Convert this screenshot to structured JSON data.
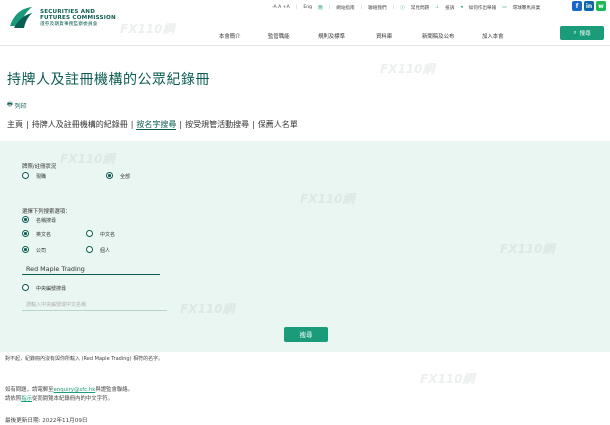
{
  "header": {
    "org_line1": "SECURITIES AND",
    "org_line2": "FUTURES COMMISSION",
    "org_chinese": "證券及期貨事務監察委員會",
    "utility": [
      "-A A +A",
      "Eng",
      "簡",
      "網站指南",
      "聯絡我們",
      "常見問題",
      "投訴",
      "如何作出舉報",
      "環球賽馬商業",
      "新聞稿"
    ],
    "search_label": "搜尋",
    "nav": [
      "本會簡介",
      "監管職能",
      "規則及標準",
      "資料庫",
      "新聞稿及公布",
      "加入本會"
    ]
  },
  "page": {
    "title": "持牌人及註冊機構的公眾紀錄冊",
    "print_label": "列印"
  },
  "breadcrumb": {
    "items": [
      "主頁",
      "持牌人及註冊機構的紀錄冊",
      "按名字搜尋",
      "按受規管活動搜尋",
      "保薦人名單"
    ],
    "active_index": 2
  },
  "form": {
    "status_label": "牌照/註冊狀況",
    "status_options": [
      "現職",
      "全部"
    ],
    "status_selected": "全部",
    "criteria_label": "選擇下列搜索選項：",
    "by_name_label": "名稱搜尋",
    "name_lang_options": [
      "英文名",
      "中文名"
    ],
    "name_lang_selected": "英文名",
    "entity_options": [
      "公司",
      "個人"
    ],
    "entity_selected": "公司",
    "name_value": "Red Maple Trading",
    "chinese_search_label": "中央編號搜尋",
    "chinese_placeholder": "請輸入中央編號或中文名稱",
    "submit_label": "搜尋"
  },
  "footer": {
    "note": "對不起，紀錄冊內沒有與你所輸入 (Red Maple Trading) 相符的名字。",
    "contact_prefix": "如有問題，請電郵至",
    "contact_email": "enquiry@sfc.hk",
    "contact_suffix": "與證監會聯絡。",
    "line2_prefix": "請依照",
    "line2_link": "指示",
    "line2_suffix": "從而閱覽本紀錄冊內的中文字符。",
    "updated": "最後更新日期: 2022年11月09日"
  },
  "watermark": "FX110網",
  "colors": {
    "primary": "#0b5c52",
    "accent": "#1a9c7a",
    "panel_bg": "#e9f6f2"
  }
}
